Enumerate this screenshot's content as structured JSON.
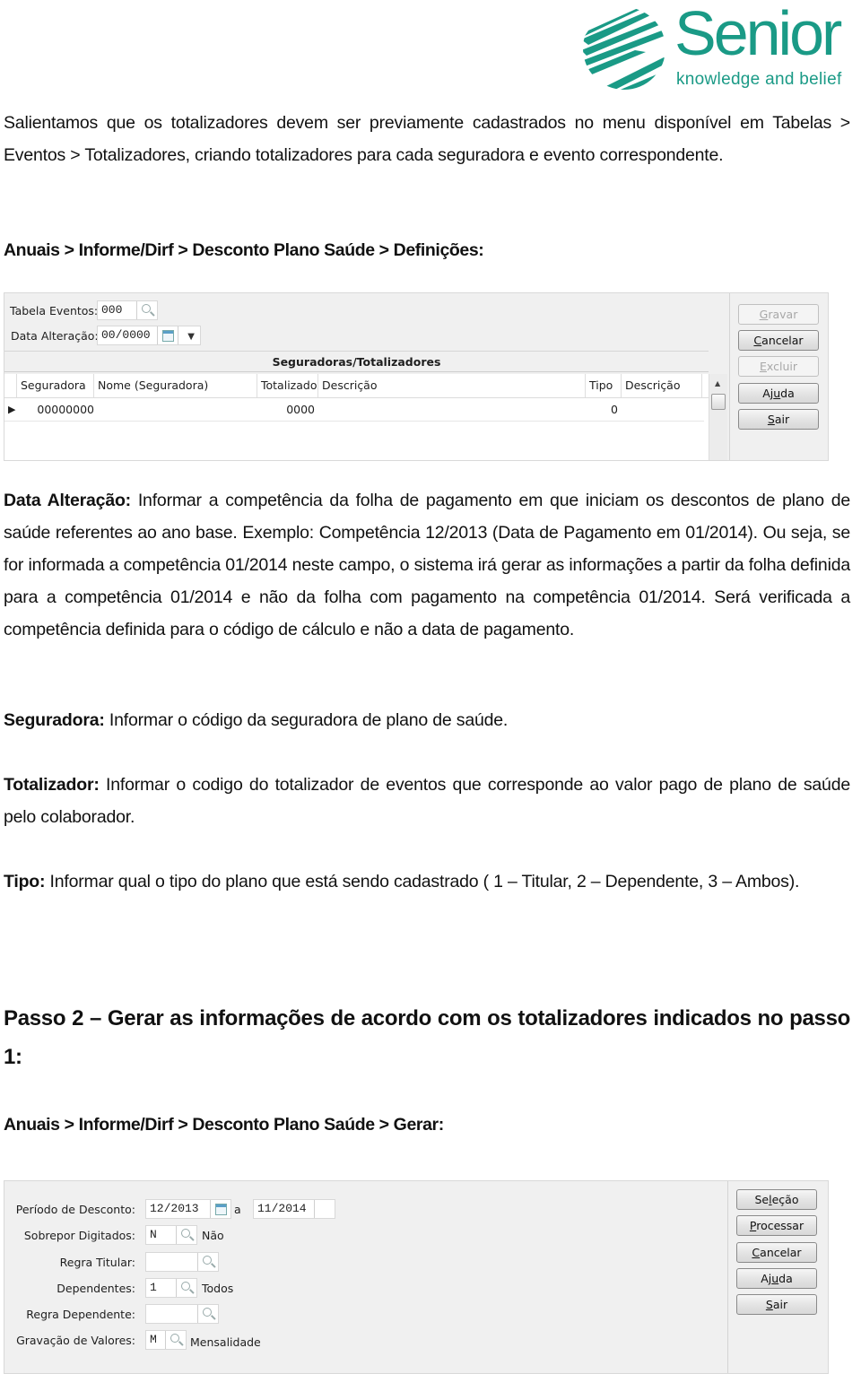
{
  "logo": {
    "brand": "Senior",
    "tagline": "knowledge and belief",
    "color": "#1a9a86"
  },
  "intro": {
    "text": "Salientamos que os totalizadores devem ser previamente cadastrados no menu disponível em Tabelas > Eventos > Totalizadores, criando totalizadores para cada seguradora e evento correspondente."
  },
  "path1": "Anuais > Informe/Dirf > Desconto Plano Saúde > Definições:",
  "window1": {
    "fields": {
      "tabela_eventos_label": "Tabela Eventos:",
      "tabela_eventos_value": "000",
      "data_alteracao_label": "Data Alteração:",
      "data_alteracao_value": "00/0000"
    },
    "grid_title": "Seguradoras/Totalizadores",
    "columns": [
      "Seguradora",
      "Nome (Seguradora)",
      "Totalizado",
      "Descrição",
      "Tipo",
      "Descrição"
    ],
    "rows": [
      {
        "seguradora": "00000000",
        "nome": "",
        "totalizado": "0000",
        "descricao": "",
        "tipo": "0",
        "descricao2": ""
      }
    ],
    "buttons": [
      {
        "label": "Gravar",
        "mnemonic": "G",
        "disabled": true
      },
      {
        "label": "Cancelar",
        "mnemonic": "C",
        "disabled": false
      },
      {
        "label": "Excluir",
        "mnemonic": "E",
        "disabled": true
      },
      {
        "label": "Ajuda",
        "mnemonic": "u",
        "disabled": false
      },
      {
        "label": "Sair",
        "mnemonic": "S",
        "disabled": false
      }
    ]
  },
  "descriptions": {
    "data_alteracao": {
      "term": "Data Alteração:",
      "text": " Informar a competência da folha de pagamento em que iniciam os descontos de plano de saúde referentes ao ano base. Exemplo: Competência 12/2013 (Data de Pagamento em 01/2014). Ou seja, se for informada a competência 01/2014 neste campo, o sistema irá gerar as informações a partir da folha definida para a competência 01/2014 e não da folha com pagamento na competência 01/2014. Será verificada a competência definida para o código de cálculo e não a data de pagamento."
    },
    "seguradora": {
      "term": "Seguradora:",
      "text": " Informar o código da seguradora de plano de saúde."
    },
    "totalizador": {
      "term": "Totalizador:",
      "text": " Informar o codigo do totalizador de eventos que corresponde ao valor pago de plano de saúde pelo colaborador."
    },
    "tipo": {
      "term": "Tipo:",
      "text": " Informar qual o tipo do plano que está sendo cadastrado ( 1 – Titular,  2 – Dependente, 3 – Ambos)."
    }
  },
  "step2": {
    "heading": "Passo 2 – Gerar as informações de acordo com os totalizadores indicados no passo 1:",
    "path": "Anuais > Informe/Dirf > Desconto Plano Saúde > Gerar:"
  },
  "window2": {
    "periodo_label": "Período de Desconto:",
    "periodo_from": "12/2013",
    "periodo_sep": "a",
    "periodo_to": "11/2014",
    "sobrepor_label": "Sobrepor Digitados:",
    "sobrepor_value": "N",
    "sobrepor_desc": "Não",
    "regra_titular_label": "Regra Titular:",
    "regra_titular_value": "",
    "dependentes_label": "Dependentes:",
    "dependentes_value": "1",
    "dependentes_desc": "Todos",
    "regra_dependente_label": "Regra Dependente:",
    "regra_dependente_value": "",
    "gravacao_label": "Gravação de Valores:",
    "gravacao_value": "M",
    "gravacao_desc": "Mensalidade",
    "buttons": [
      {
        "label": "Seleção",
        "mnemonic": "l",
        "disabled": false
      },
      {
        "label": "Processar",
        "mnemonic": "P",
        "disabled": false
      },
      {
        "label": "Cancelar",
        "mnemonic": "C",
        "disabled": false
      },
      {
        "label": "Ajuda",
        "mnemonic": "u",
        "disabled": false
      },
      {
        "label": "Sair",
        "mnemonic": "S",
        "disabled": false
      }
    ]
  }
}
